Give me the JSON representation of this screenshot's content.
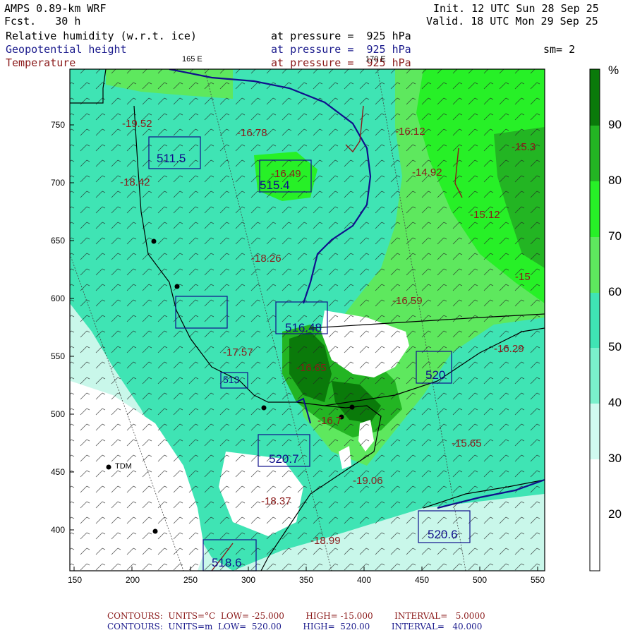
{
  "header": {
    "model": "AMPS 0.89-km WRF",
    "forecast": "Fcst.   30 h",
    "init": "Init. 12 UTC Sun 28 Sep 25",
    "valid": "Valid. 18 UTC Mon 29 Sep 25",
    "fields": [
      {
        "name": "Relative humidity (w.r.t. ice)",
        "level": "at pressure =  925 hPa"
      },
      {
        "name": "Geopotential height",
        "level": "at pressure =  925 hPa"
      },
      {
        "name": "Temperature",
        "level": "at pressure =  925 hPa"
      }
    ],
    "smoothing": "sm= 2"
  },
  "map": {
    "lon_labels": [
      "165 E",
      "170 E"
    ],
    "x_ticks": [
      "150",
      "200",
      "250",
      "300",
      "350",
      "400",
      "450",
      "500",
      "550"
    ],
    "y_ticks": [
      "750",
      "700",
      "650",
      "600",
      "550",
      "500",
      "450",
      "400"
    ],
    "stations": [
      {
        "id": "TDM"
      }
    ],
    "height_labels": [
      "511.5",
      "515.4",
      "513",
      "516.48",
      "520",
      "520.7",
      "520.6",
      "518.6"
    ],
    "temp_labels": [
      "-19.52",
      "-16.78",
      "-18.42",
      "-16.49",
      "-18.26",
      "-16.12",
      "-14.92",
      "-15.3",
      "-15.12",
      "-15",
      "-16.59",
      "-16.29",
      "-17.57",
      "-16.65",
      "-16.7",
      "-15.65",
      "-19.06",
      "-18.37",
      "-18.99"
    ],
    "colors": {
      "rh_green_dark": "#0a7a0a",
      "rh_green": "#2bd82b",
      "rh_cyan": "#3fe4b4",
      "rh_pale": "#c9f7ea",
      "height_contour": "#10108c",
      "temp_contour": "#8b1a1a"
    }
  },
  "colorbar": {
    "unit": "%",
    "levels": [
      "90",
      "80",
      "70",
      "60",
      "50",
      "40",
      "30",
      "20"
    ],
    "colors": [
      "#0a7a0a",
      "#23b523",
      "#27f027",
      "#5ee85e",
      "#3fe4b4",
      "#7af0cc",
      "#d0faf0",
      "#ffffff"
    ]
  },
  "footer": {
    "line1": "CONTOURS:  UNITS=°C  LOW= -25.000        HIGH= -15.000        INTERVAL=   5.0000",
    "line2": "CONTOURS:  UNITS=m  LOW=  520.00        HIGH=  520.00        INTERVAL=   40.000"
  }
}
